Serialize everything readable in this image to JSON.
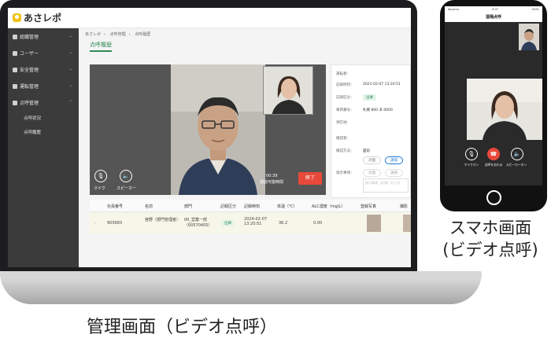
{
  "app": {
    "logo_text": "あさレポ"
  },
  "sidebar": {
    "items": [
      {
        "label": "組織管理",
        "icon": "share-icon"
      },
      {
        "label": "ユーザー",
        "icon": "user-icon"
      },
      {
        "label": "安全管理",
        "icon": "safety-icon"
      },
      {
        "label": "運転管理",
        "icon": "driving-icon"
      },
      {
        "label": "点呼管理",
        "icon": "rollcall-icon"
      }
    ],
    "sub_items": [
      "点呼状況",
      "点呼履歴"
    ]
  },
  "breadcrumb": [
    "あさレポ",
    "点呼管理",
    "点呼履歴"
  ],
  "page_tab": "点呼履歴",
  "video": {
    "mic_label": "マイク",
    "speaker_label": "スピーカー",
    "timer": "00:39",
    "timer_label": "通話可能時間",
    "end_button": "終了"
  },
  "info_panel": {
    "rows": [
      {
        "label": "運転者：",
        "value": ""
      },
      {
        "label": "記録時刻：",
        "value": "2021-02-07 13:20:51"
      },
      {
        "label": "記録区分：",
        "value": "出庫"
      },
      {
        "label": "車両番号：",
        "value": "札幌 800 あ 0000"
      },
      {
        "label": "現在地：",
        "value": ""
      },
      {
        "label": "確認者：",
        "value": ""
      },
      {
        "label": "確認方法：",
        "value": "面前"
      }
    ],
    "radio_options": [
      "対面",
      "遠隔"
    ],
    "second_radio_options": [
      "対面",
      "遠隔"
    ],
    "instruction_label": "指示事項：",
    "textarea_placeholder": "指示事項（必須）を入力"
  },
  "table": {
    "headers": [
      "社員番号",
      "名前",
      "部門",
      "記録区分",
      "記録時刻",
      "体温（℃）",
      "ALC濃度（mg/L）",
      "登録写真",
      "撮影"
    ],
    "row": {
      "employee_no": "905683",
      "name": "宮野（部門管理者）",
      "department": "00_営業一部（00570405）",
      "category": "出庫",
      "record_time": "2024-02-07 13:20:51",
      "temperature": "36.2",
      "alc": "0.00"
    }
  },
  "phone": {
    "status_left": "docomo",
    "status_center": "9:07",
    "status_right": "100%",
    "header": "遠隔点呼",
    "buttons": [
      "マイクオン",
      "点呼をおわる",
      "スピーカーオン"
    ]
  },
  "captions": {
    "phone": "スマホ画面\n(ビデオ点呼)",
    "admin": "管理画面（ビデオ点呼）"
  }
}
